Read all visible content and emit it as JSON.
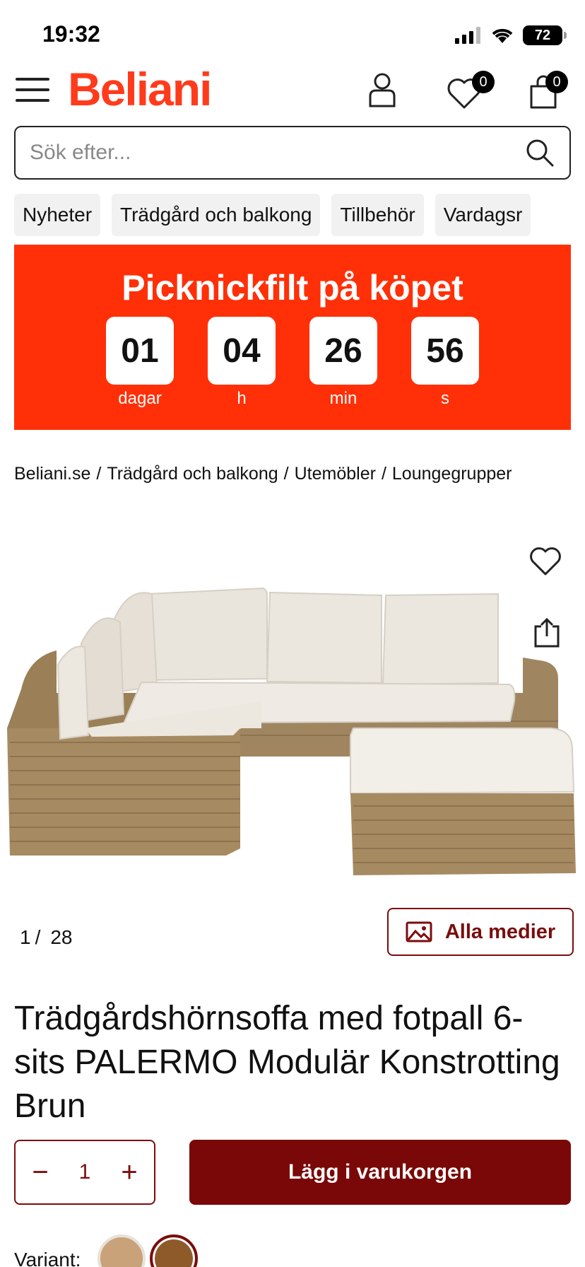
{
  "status_bar": {
    "time": "19:32",
    "battery": "72"
  },
  "header": {
    "logo": "Beliani",
    "wishlist_count": "0",
    "cart_count": "0"
  },
  "search": {
    "placeholder": "Sök efter..."
  },
  "categories": [
    "Nyheter",
    "Trädgård och balkong",
    "Tillbehör",
    "Vardagsr"
  ],
  "promo": {
    "title": "Picknickfilt på köpet",
    "countdown": [
      {
        "value": "01",
        "label": "dagar"
      },
      {
        "value": "04",
        "label": "h"
      },
      {
        "value": "26",
        "label": "min"
      },
      {
        "value": "56",
        "label": "s"
      }
    ],
    "color": "#ff3008"
  },
  "breadcrumb": [
    "Beliani.se",
    "Trädgård och balkong",
    "Utemöbler",
    "Loungegrupper"
  ],
  "gallery": {
    "current": "1",
    "total": "28",
    "all_media_label": "Alla medier"
  },
  "product": {
    "title": "Trädgårdshörnsoffa med fotpall 6-sits PALERMO Modulär Konstrotting Brun"
  },
  "cart": {
    "quantity": "1",
    "add_label": "Lägg i varukorgen",
    "button_color": "#7a0808"
  },
  "variant": {
    "label": "Variant:",
    "swatches": [
      "#c9a27a",
      "#8f5a2a"
    ]
  },
  "colors": {
    "brand": "#ff3b1c",
    "accent": "#7a0d0d"
  }
}
